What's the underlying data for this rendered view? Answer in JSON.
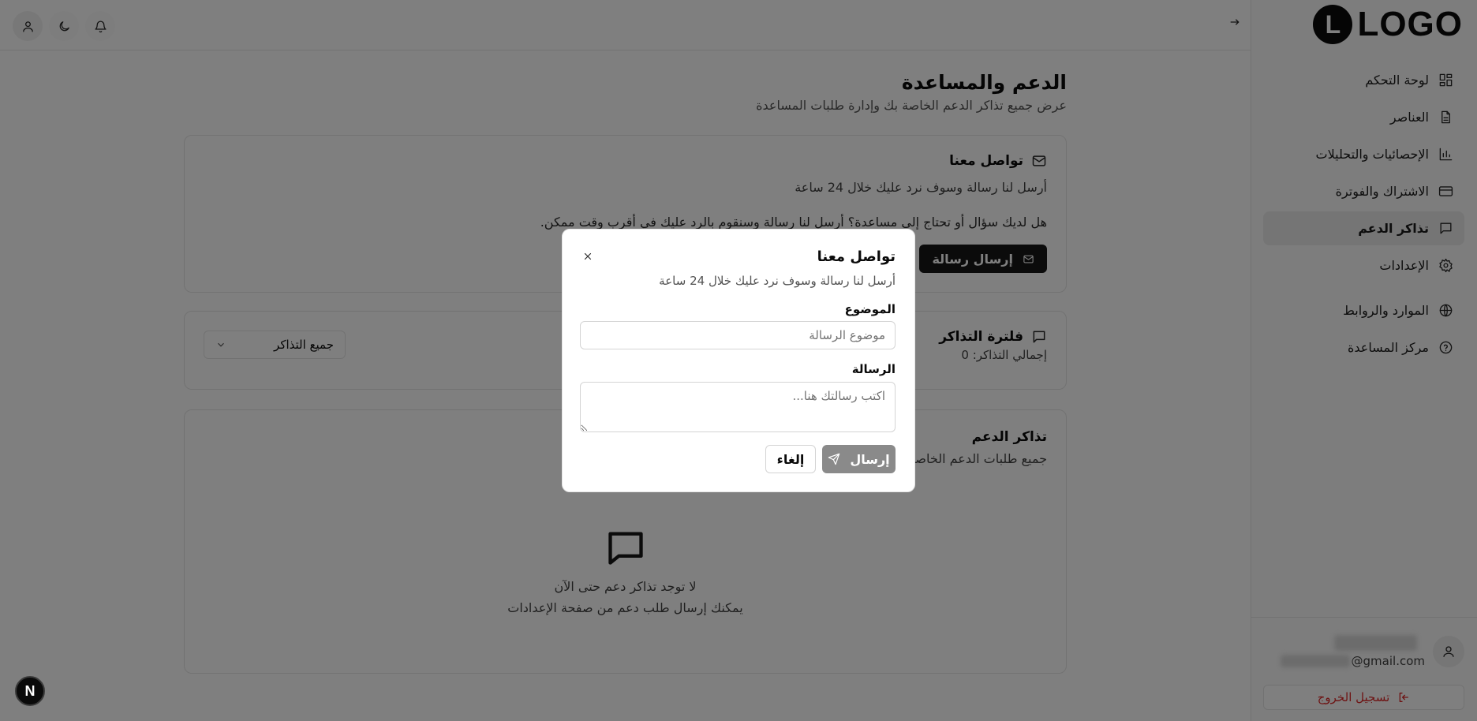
{
  "logo": {
    "badge": "L",
    "text": "LOGO"
  },
  "sidebar": {
    "items": [
      {
        "label": "لوحة التحكم",
        "icon": "dashboard-icon"
      },
      {
        "label": "العناصر",
        "icon": "file-text-icon"
      },
      {
        "label": "الإحصائيات والتحليلات",
        "icon": "bar-chart-icon"
      },
      {
        "label": "الاشتراك والفوترة",
        "icon": "credit-card-icon"
      },
      {
        "label": "تذاكر الدعم",
        "icon": "message-square-icon",
        "active": true
      },
      {
        "label": "الإعدادات",
        "icon": "gear-icon"
      },
      {
        "label": "الموارد والروابط",
        "icon": "globe-icon"
      },
      {
        "label": "مركز المساعدة",
        "icon": "help-circle-icon"
      }
    ],
    "user": {
      "email_suffix": "@gmail.com"
    },
    "logout_label": "تسجيل الخروج"
  },
  "header": {
    "icons": [
      "user-icon",
      "moon-icon",
      "bell-icon"
    ],
    "collapse_icon": "arrow-right-icon"
  },
  "page": {
    "title": "الدعم والمساعدة",
    "subtitle": "عرض جميع تذاكر الدعم الخاصة بك وإدارة طلبات المساعدة"
  },
  "contact_card": {
    "title": "تواصل معنا",
    "subtitle": "أرسل لنا رسالة وسوف نرد عليك خلال 24 ساعة",
    "body": "هل لديك سؤال أو تحتاج إلى مساعدة؟ أرسل لنا رسالة وسنقوم بالرد عليك في أقرب وقت ممكن.",
    "button_label": "إرسال رسالة"
  },
  "filter_card": {
    "title": "فلترة التذاكر",
    "total_label": "إجمالي التذاكر: 0",
    "select_value": "جميع التذاكر"
  },
  "tickets_card": {
    "title": "تذاكر الدعم",
    "subtitle": "جميع طلبات الدعم الخاصة بك",
    "empty_title": "لا توجد تذاكر دعم حتى الآن",
    "empty_subtitle": "يمكنك إرسال طلب دعم من صفحة الإعدادات"
  },
  "modal": {
    "title": "تواصل معنا",
    "subtitle": "أرسل لنا رسالة وسوف نرد عليك خلال 24 ساعة",
    "subject_label": "الموضوع",
    "subject_value": "",
    "subject_placeholder": "موضوع الرسالة",
    "message_label": "الرسالة",
    "message_value": "",
    "message_placeholder": "اكتب رسالتك هنا...",
    "send_label": "إرسال",
    "cancel_label": "إلغاء"
  },
  "dev_badge": "N",
  "colors": {
    "primary": "#171717",
    "danger": "#dc2626",
    "overlay": "rgba(0,0,0,0.5)",
    "active_nav_bg": "#ebebeb"
  }
}
